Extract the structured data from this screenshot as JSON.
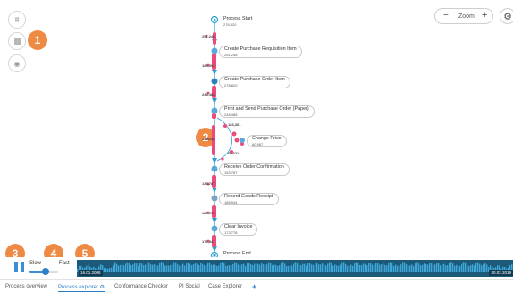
{
  "toolbar": {
    "tools": [
      {
        "name": "filter-icon",
        "glyph": "⩩"
      },
      {
        "name": "stop-icon",
        "glyph": ""
      },
      {
        "name": "eye-off-icon",
        "glyph": "◉"
      }
    ],
    "zoom": {
      "minus": "−",
      "label": "Zoom",
      "plus": "+"
    },
    "settings_glyph": "⚙"
  },
  "callouts": [
    "1",
    "2",
    "3",
    "4",
    "5"
  ],
  "process_map": {
    "colors": {
      "flow": "#2a9fd6",
      "token": "#ec4a7b",
      "node": "#5aa9d9"
    },
    "start": {
      "name": "Process Start",
      "count": "278,820"
    },
    "activities": [
      {
        "name": "Create Purchase Requisition Item",
        "count": "251,248"
      },
      {
        "name": "Create Purchase Order Item",
        "count": "278,820"
      },
      {
        "name": "Print and Send Purchase Order (Paper)",
        "count": "248,488"
      },
      {
        "name": "Change Price",
        "count": "60,967"
      },
      {
        "name": "Receive Order Confirmation",
        "count": "153,787"
      },
      {
        "name": "Record Goods Receipt",
        "count": "186,944"
      },
      {
        "name": "Clear Invoice",
        "count": "173,778"
      }
    ],
    "end": {
      "name": "Process End",
      "count": "278,820"
    },
    "edge_labels": [
      "251,248",
      "185,994",
      "248,488",
      "183,361",
      "153,248",
      "60,821",
      "133,787",
      "186,978",
      "172,847"
    ]
  },
  "playback": {
    "speed_slow": "Slow",
    "speed_fast": "Fast",
    "speed_level": 0.55,
    "start_date": "16.01.2008",
    "end_date": "30.02.2019",
    "colors": {
      "timeline_bg": "#1d5a7a",
      "histogram": "#3fa7d8"
    }
  },
  "tabs": [
    {
      "label": "Process overview"
    },
    {
      "label": "Process explorer ⚙",
      "active": true
    },
    {
      "label": "Conformance Checker"
    },
    {
      "label": "PI Social"
    },
    {
      "label": "Case Explorer"
    }
  ],
  "add_tab": "+"
}
